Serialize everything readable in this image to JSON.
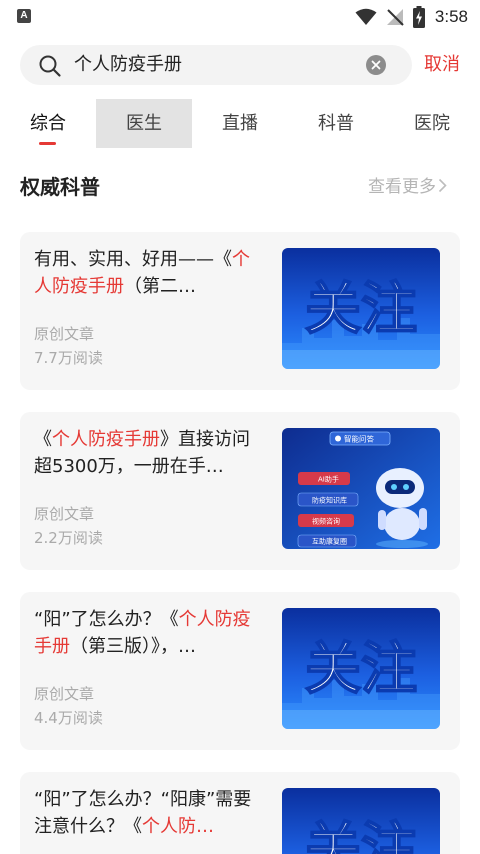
{
  "status_bar": {
    "app_icon_letter": "A",
    "time": "3:58"
  },
  "search": {
    "query": "个人防疫手册",
    "cancel_label": "取消"
  },
  "tabs": [
    {
      "label": "综合",
      "active": true
    },
    {
      "label": "医生",
      "active": false
    },
    {
      "label": "直播",
      "active": false
    },
    {
      "label": "科普",
      "active": false
    },
    {
      "label": "医院",
      "active": false
    }
  ],
  "section": {
    "title": "权威科普",
    "more_label": "查看更多"
  },
  "cards": [
    {
      "title_parts": [
        {
          "text": "有用、实用、好用——《",
          "highlight": false
        },
        {
          "text": "个人防疫手册",
          "highlight": true
        },
        {
          "text": "（第二…",
          "highlight": false
        }
      ],
      "source": "原创文章",
      "reads": "7.7万阅读",
      "thumb_type": "follow",
      "thumb_text": "关注"
    },
    {
      "title_parts": [
        {
          "text": "《",
          "highlight": false
        },
        {
          "text": "个人防疫手册",
          "highlight": true
        },
        {
          "text": "》直接访问超5300万，一册在手…",
          "highlight": false
        }
      ],
      "source": "原创文章",
      "reads": "2.2万阅读",
      "thumb_type": "robot",
      "thumb_labels": [
        "智能问答",
        "AI助手",
        "防疫知识库",
        "视频咨询",
        "互助康复圈"
      ]
    },
    {
      "title_parts": [
        {
          "text": "“阳”了怎么办？《",
          "highlight": false
        },
        {
          "text": "个人防疫手册",
          "highlight": true
        },
        {
          "text": "（第三版）》，…",
          "highlight": false
        }
      ],
      "source": "原创文章",
      "reads": "4.4万阅读",
      "thumb_type": "follow",
      "thumb_text": "关注"
    },
    {
      "title_parts": [
        {
          "text": "“阳”了怎么办？“阳康”需要注意什么？《",
          "highlight": false
        },
        {
          "text": "个人防…",
          "highlight": true
        }
      ],
      "source": "",
      "reads": "",
      "thumb_type": "follow",
      "thumb_text": "关注"
    }
  ],
  "colors": {
    "accent": "#e53935",
    "card_bg": "#f6f6f6",
    "thumb_blue": "#1a56d6"
  }
}
